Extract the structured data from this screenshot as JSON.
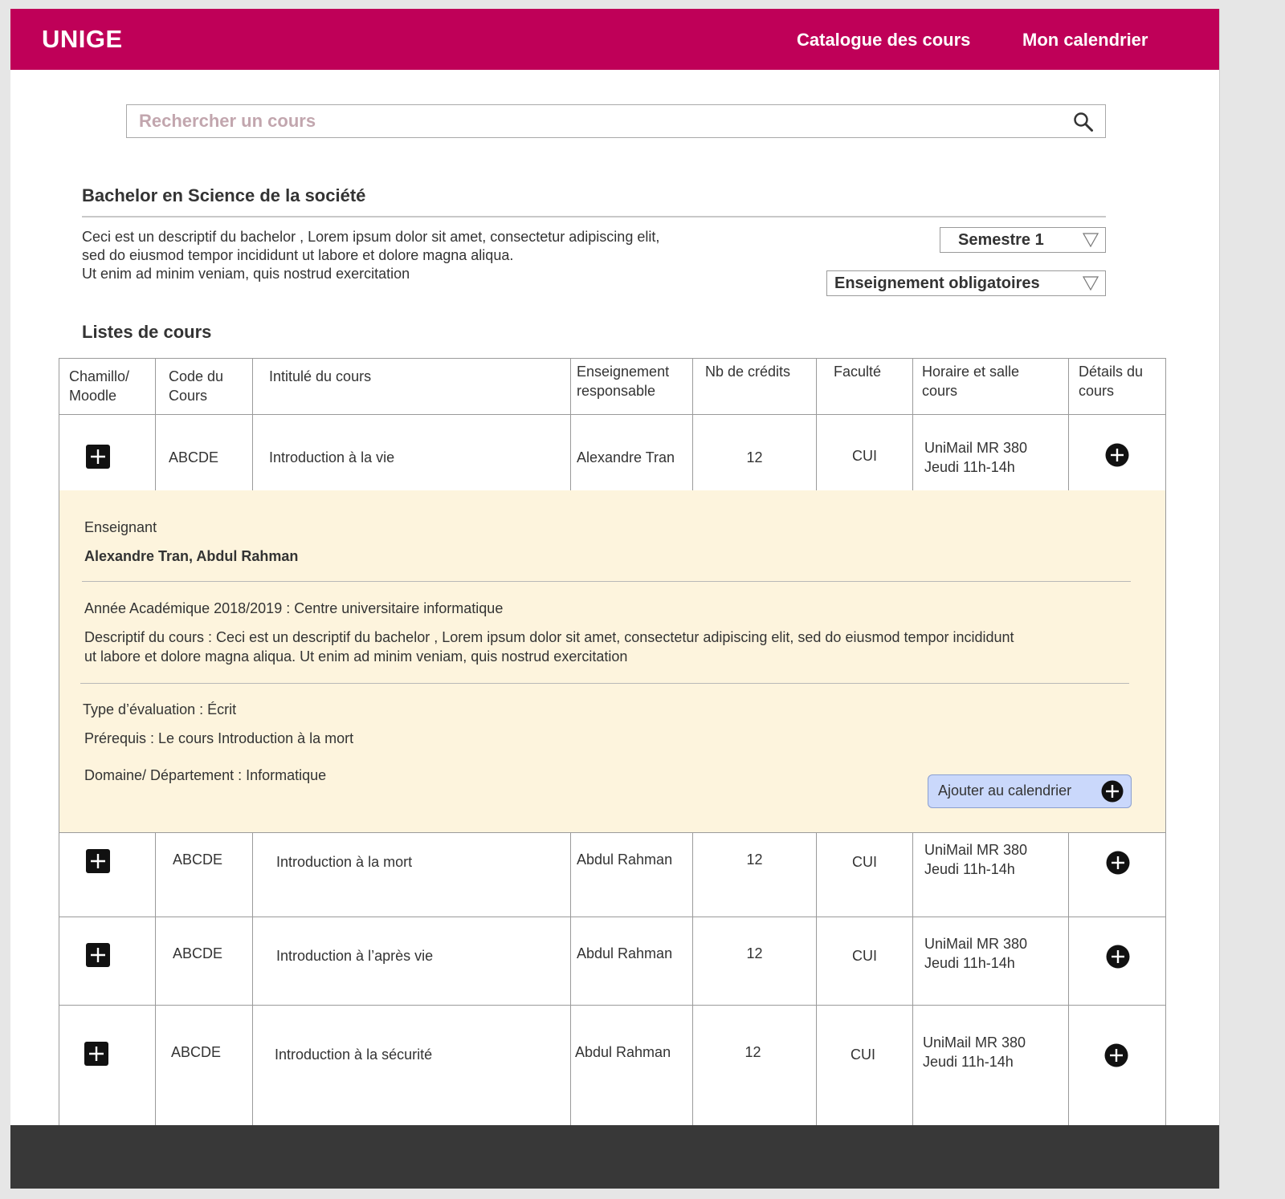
{
  "header": {
    "logo": "UNIGE",
    "nav": [
      "Catalogue des cours",
      "Mon calendrier"
    ]
  },
  "search": {
    "placeholder": "Rechercher un cours",
    "value": ""
  },
  "program": {
    "title": "Bachelor en Science de la société",
    "description_lines": [
      "Ceci est un descriptif du bachelor , Lorem ipsum dolor sit amet, consectetur adipiscing elit,",
      "sed do eiusmod tempor incididunt ut labore et dolore magna aliqua.",
      "Ut enim ad minim veniam, quis nostrud exercitation"
    ]
  },
  "filters": {
    "semester": "Semestre 1",
    "teaching": "Enseignement obligatoires"
  },
  "list_title": "Listes de cours",
  "table": {
    "headers": [
      [
        "Chamillo/",
        "Moodle"
      ],
      [
        "Code du",
        "Cours"
      ],
      [
        "Intitulé du cours"
      ],
      [
        "Enseignement",
        "responsable"
      ],
      [
        "Nb de crédits"
      ],
      [
        "Faculté"
      ],
      [
        "Horaire et salle",
        "cours"
      ],
      [
        "Détails du",
        "cours"
      ]
    ],
    "rows": [
      {
        "code": "ABCDE",
        "title": "Introduction à la vie",
        "responsible": "Alexandre Tran",
        "credits": "12",
        "faculty": "CUI",
        "room": "UniMail MR  380",
        "time": "Jeudi 11h-14h"
      },
      {
        "code": "ABCDE",
        "title": "Introduction à la mort",
        "responsible": "Abdul Rahman",
        "credits": "12",
        "faculty": "CUI",
        "room": "UniMail MR  380",
        "time": "Jeudi 11h-14h"
      },
      {
        "code": "ABCDE",
        "title": "Introduction à l’après vie",
        "responsible": "Abdul Rahman",
        "credits": "12",
        "faculty": "CUI",
        "room": "UniMail MR  380",
        "time": "Jeudi 11h-14h"
      },
      {
        "code": "ABCDE",
        "title": "Introduction à la sécurité",
        "responsible": "Abdul Rahman",
        "credits": "12",
        "faculty": "CUI",
        "room": "UniMail MR  380",
        "time": "Jeudi 11h-14h"
      }
    ]
  },
  "details": {
    "teacher_label": "Enseignant",
    "teachers": "Alexandre Tran, Abdul Rahman",
    "academic_year": "Année Académique 2018/2019 : Centre universitaire informatique",
    "description_lines": [
      "Descriptif du cours : Ceci est un descriptif du bachelor , Lorem ipsum dolor sit amet, consectetur adipiscing elit, sed do eiusmod tempor incididunt",
      "ut labore et dolore magna aliqua. Ut enim ad minim veniam, quis nostrud exercitation"
    ],
    "evaluation": "Type d’évaluation : Écrit",
    "prerequisites": "Prérequis : Le cours Introduction à la mort",
    "domain": "Domaine/ Département :  Informatique",
    "add_button": "Ajouter au calendrier"
  },
  "colors": {
    "brand": "#bf0058",
    "details_bg": "#fdf4dd",
    "button_bg": "#cad8fb",
    "footer": "#383838"
  },
  "icons": {
    "search": "search-icon",
    "dropdown": "triangle-down-icon",
    "expand": "plus-square-icon",
    "details": "plus-circle-icon"
  }
}
